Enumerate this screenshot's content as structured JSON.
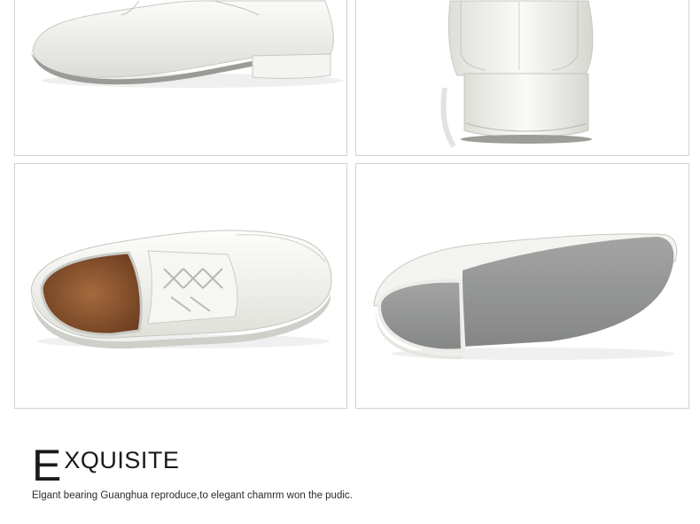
{
  "headline": {
    "initial": "E",
    "rest": "XQUISITE"
  },
  "tagline": "Elgant bearing Guanghua reproduce,to elegant chamrm won the pudic.",
  "photos": [
    {
      "name": "shoe-side-toe-view"
    },
    {
      "name": "shoe-heel-back-view"
    },
    {
      "name": "shoe-top-laced-view"
    },
    {
      "name": "shoe-sole-bottom-view"
    }
  ],
  "colors": {
    "panel_border": "#d2d2d2",
    "leather": "#f1f1ee",
    "sole": "#8f9090",
    "lining": "#7a4a28"
  }
}
